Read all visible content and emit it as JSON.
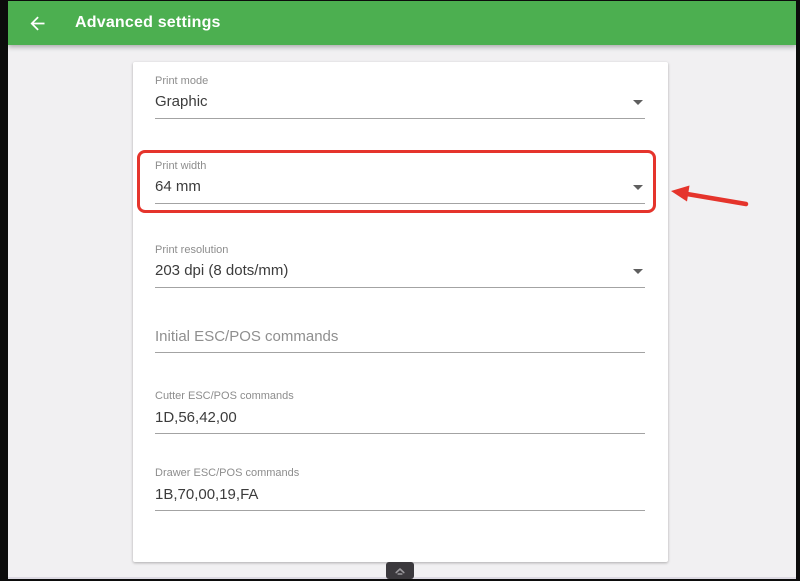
{
  "header": {
    "title": "Advanced settings",
    "background_color": "#4caf50",
    "back_icon": "arrow-left"
  },
  "card": {
    "fields": [
      {
        "label": "Print mode",
        "value": "Graphic",
        "type": "dropdown"
      },
      {
        "label": "Print width",
        "value": "64 mm",
        "type": "dropdown",
        "highlighted": true
      },
      {
        "label": "Print resolution",
        "value": "203 dpi (8 dots/mm)",
        "type": "dropdown"
      },
      {
        "label": "Initial ESC/POS commands",
        "value": "",
        "placeholder": "Initial ESC/POS commands",
        "type": "text"
      },
      {
        "label": "Cutter ESC/POS commands",
        "value": "1D,56,42,00",
        "type": "text"
      },
      {
        "label": "Drawer ESC/POS commands",
        "value": "1B,70,00,19,FA",
        "type": "text"
      }
    ]
  },
  "annotations": {
    "highlight_target": "Print width",
    "highlight_color": "#e5342c",
    "arrow_icon": "arrow-pointing-left-to-print-width"
  },
  "nav_handle": {
    "icon": "chevron-up"
  }
}
